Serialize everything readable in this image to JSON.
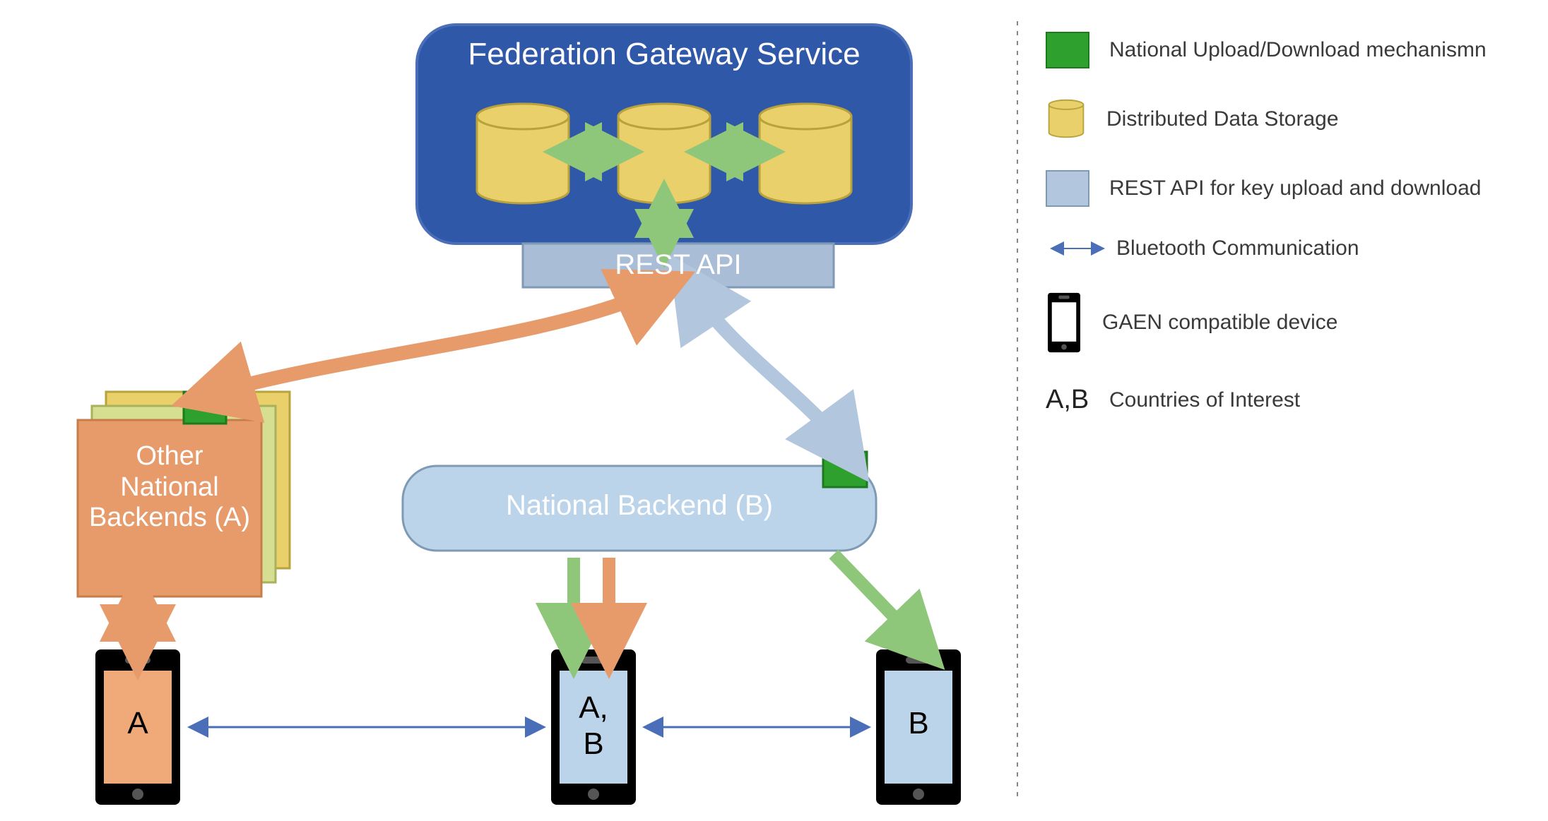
{
  "gateway": {
    "title": "Federation Gateway Service",
    "rest_api_label": "REST API"
  },
  "other_national_backends": {
    "label": "Other\nNational\nBackends (A)"
  },
  "national_backend_b": {
    "label": "National Backend (B)"
  },
  "phones": {
    "a": "A",
    "ab": "A,\nB",
    "b": "B"
  },
  "legend": {
    "upload_download": "National Upload/Download mechanismn",
    "distributed_storage": "Distributed Data Storage",
    "rest_api": "REST API for key upload and download",
    "bluetooth": "Bluetooth Communication",
    "gaen_device": "GAEN compatible device",
    "countries": "Countries of Interest",
    "ab_key": "A,B"
  },
  "colors": {
    "gateway_fill": "#3058a8",
    "gateway_stroke": "#4a6fb8",
    "rest_api_fill": "#a9bdd6",
    "rest_api_stroke": "#7f9ab5",
    "db_fill": "#e9d06a",
    "db_stroke": "#b8a23b",
    "nat_b_fill": "#bcd4e9",
    "nat_b_stroke": "#7f9ab5",
    "other_a_front": "#e79b6b",
    "other_a_mid": "#d6de91",
    "other_a_back": "#e9d06a",
    "green_box": "#2da02d",
    "phone_black": "#000000",
    "phone_a_screen": "#f0a978",
    "phone_b_screen": "#bcd4e9",
    "arrow_orange": "#e79b6b",
    "arrow_lightblue": "#b2c7de",
    "arrow_green": "#8fc77a",
    "arrow_bt": "#4a6fb8"
  }
}
